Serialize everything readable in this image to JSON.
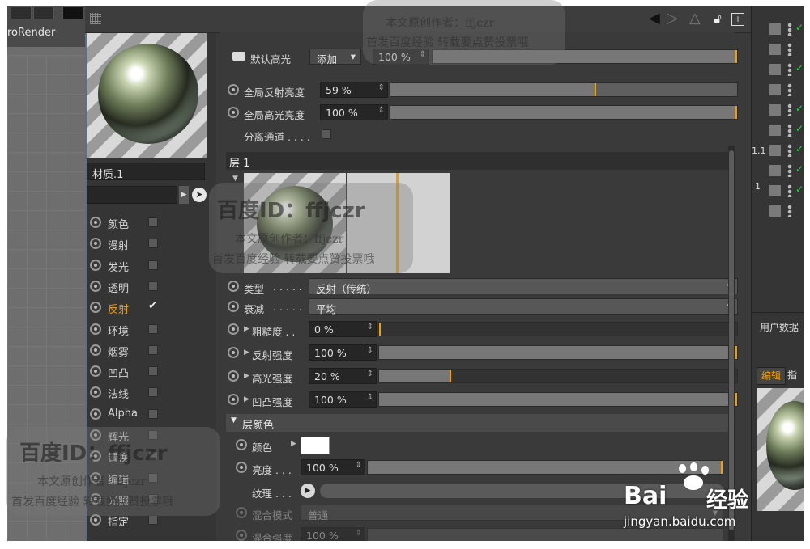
{
  "viewport": {
    "label": "roRender"
  },
  "material": {
    "name": "材质.1",
    "search_placeholder": ""
  },
  "channels": [
    {
      "name": "颜色",
      "checked": false,
      "active": false
    },
    {
      "name": "漫射",
      "checked": false,
      "active": false
    },
    {
      "name": "发光",
      "checked": false,
      "active": false
    },
    {
      "name": "透明",
      "checked": false,
      "active": false
    },
    {
      "name": "反射",
      "checked": true,
      "active": true
    },
    {
      "name": "环境",
      "checked": false,
      "active": false
    },
    {
      "name": "烟雾",
      "checked": false,
      "active": false
    },
    {
      "name": "凹凸",
      "checked": false,
      "active": false
    },
    {
      "name": "法线",
      "checked": false,
      "active": false
    },
    {
      "name": "Alpha",
      "checked": false,
      "active": false
    },
    {
      "name": "辉光",
      "checked": false,
      "active": false
    },
    {
      "name": "置换",
      "checked": false,
      "active": false
    },
    {
      "name": "编辑",
      "checked": false,
      "active": false
    },
    {
      "name": "光照",
      "checked": false,
      "active": false
    },
    {
      "name": "指定",
      "checked": false,
      "active": false
    }
  ],
  "reflection": {
    "default_specular_label": "默认高光",
    "default_specular_mode": "添加",
    "default_specular_value": "100 %",
    "default_specular_level": 1.0,
    "global_reflection_label": "全局反射亮度",
    "global_reflection_value": "59 %",
    "global_reflection_level": 0.59,
    "global_specular_label": "全局高光亮度",
    "global_specular_value": "100 %",
    "global_specular_level": 1.0,
    "separate_pass_label": "分离通道 . . . ."
  },
  "layer": {
    "title": "层 1",
    "type_label": "类型",
    "type_dots": ". . . . .",
    "type_value": "反射（传统）",
    "falloff_label": "衰减",
    "falloff_dots": ". . . . .",
    "falloff_value": "平均",
    "roughness_label": "粗糙度 . .",
    "roughness_value": "0 %",
    "roughness_level": 0.0,
    "refl_strength_label": "反射强度",
    "refl_strength_value": "100 %",
    "refl_strength_level": 1.0,
    "spec_strength_label": "高光强度",
    "spec_strength_value": "20 %",
    "spec_strength_level": 0.2,
    "bump_strength_label": "凹凸强度",
    "bump_strength_value": "100 %",
    "bump_strength_level": 1.0
  },
  "layer_color": {
    "title": "层颜色",
    "color_label": "颜色",
    "color_value": "#ffffff",
    "brightness_label": "亮度 . . .",
    "brightness_value": "100 %",
    "brightness_level": 1.0,
    "texture_label": "纹理 . . .",
    "blend_mode_label": "混合模式",
    "blend_mode_value": "普通",
    "blend_strength_label": "混合强度",
    "blend_strength_value": "100 %"
  },
  "right_panel": {
    "user_data_label": "用户数据",
    "edit_tab": "编辑",
    "assign_tab": "指",
    "obj_suffix": "1.1",
    "obj_suffix2": "1"
  },
  "watermark": {
    "id_text": "百度ID：ffjczr",
    "author_text": "本文原创作者：ffjczr",
    "promo_text": "首发百度经验  转载要点赞投票哦",
    "brand": "Bai",
    "brand_cn": "经验",
    "url": "jingyan.baidu.com"
  },
  "colors": {
    "accent": "#f2a000",
    "active_channel": "#f2a000",
    "ok_check": "#2bd04a"
  }
}
